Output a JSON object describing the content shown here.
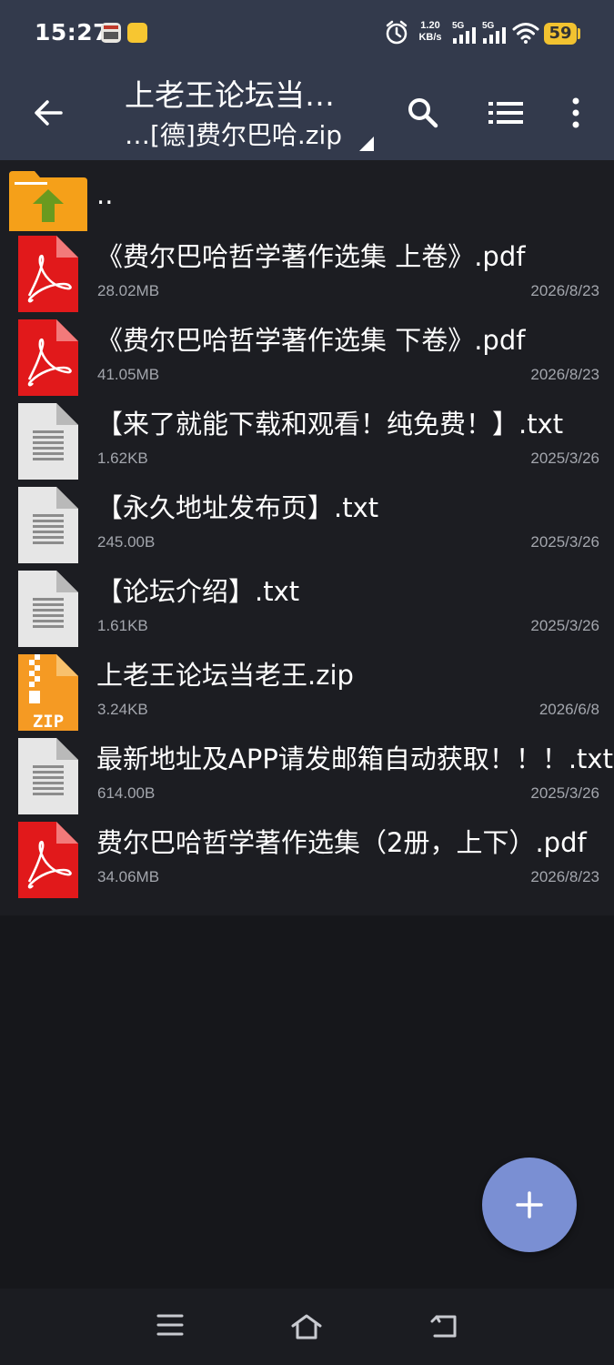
{
  "status_bar": {
    "time": "15:27",
    "net_speed_value": "1.20",
    "net_speed_unit": "KB/s",
    "signal_1": "5G",
    "signal_2": "5G",
    "battery": "59",
    "icons": [
      "app-notification-icon",
      "notes-app-icon",
      "alarm-icon",
      "signal-icon",
      "wifi-icon",
      "battery-icon"
    ]
  },
  "app_bar": {
    "title": "上老王论坛当…",
    "subtitle": "…[德]费尔巴哈.zip",
    "icons": [
      "back-arrow-icon",
      "search-icon",
      "list-view-icon",
      "more-vert-icon",
      "dropdown-triangle-icon"
    ]
  },
  "files": {
    "parent": {
      "name": "..",
      "icon": "folder-up-icon"
    },
    "items": [
      {
        "name": "《费尔巴哈哲学著作选集 上卷》.pdf",
        "size": "28.02MB",
        "date": "2026/8/23",
        "icon": "pdf-file-icon"
      },
      {
        "name": "《费尔巴哈哲学著作选集 下卷》.pdf",
        "size": "41.05MB",
        "date": "2026/8/23",
        "icon": "pdf-file-icon"
      },
      {
        "name": "【来了就能下载和观看！纯免费！】.txt",
        "size": "1.62KB",
        "date": "2025/3/26",
        "icon": "text-file-icon"
      },
      {
        "name": "【永久地址发布页】.txt",
        "size": "245.00B",
        "date": "2025/3/26",
        "icon": "text-file-icon"
      },
      {
        "name": "【论坛介绍】.txt",
        "size": "1.61KB",
        "date": "2025/3/26",
        "icon": "text-file-icon"
      },
      {
        "name": "上老王论坛当老王.zip",
        "size": "3.24KB",
        "date": "2026/6/8",
        "icon": "zip-file-icon",
        "icon_label": "ZIP"
      },
      {
        "name": "最新地址及APP请发邮箱自动获取！！！.txt",
        "size": "614.00B",
        "date": "2025/3/26",
        "icon": "text-file-icon"
      },
      {
        "name": "费尔巴哈哲学著作选集（2册，上下）.pdf",
        "size": "34.06MB",
        "date": "2026/8/23",
        "icon": "pdf-file-icon"
      }
    ]
  },
  "fab": {
    "icon": "add-icon"
  },
  "nav_bar": {
    "icons": [
      "menu-icon",
      "home-icon",
      "back-icon"
    ]
  },
  "colors": {
    "header_bg": "#333a4c",
    "list_bg": "#1c1d22",
    "fab_bg": "#7a8fd3",
    "pdf_red": "#e1191b",
    "zip_orange": "#f59a23",
    "folder_orange": "#f5a019",
    "folder_arrow": "#6a9a1f",
    "secondary_text": "#a3a6ad"
  }
}
